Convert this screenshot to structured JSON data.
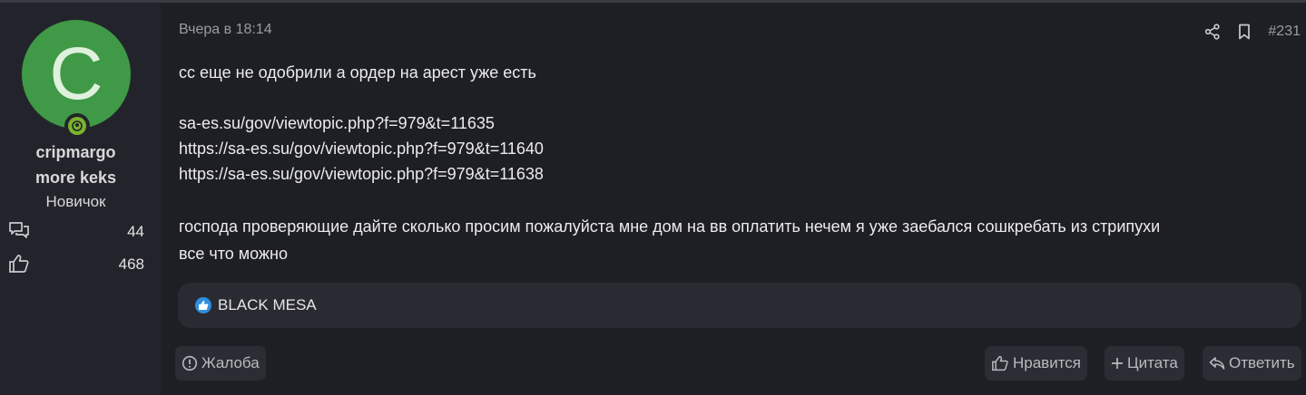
{
  "author": {
    "avatar_letter": "C",
    "name_line1": "cripmargo",
    "name_line2": "more keks",
    "rank": "Новичок",
    "messages_count": "44",
    "reactions_count": "468",
    "avatar_color": "#3f9946",
    "online_color": "#7ab32f"
  },
  "post": {
    "date": "Вчера в 18:14",
    "number": "#231",
    "lines": [
      "сс еще не одобрили а ордер на арест уже есть",
      "sa-es.su/gov/viewtopic.php?f=979&t=11635",
      "https://sa-es.su/gov/viewtopic.php?f=979&t=11640",
      "https://sa-es.su/gov/viewtopic.php?f=979&t=11638",
      "господа проверяющие дайте сколько просим пожалуйста мне дом на вв оплатить нечем я уже заебался сошкребать из стрипухи",
      "все что можно"
    ]
  },
  "reactions": {
    "users": "BLACK MESA",
    "icon": "thumbs-up-icon",
    "badge_color": "#2f8fe0"
  },
  "actions": {
    "report": "Жалоба",
    "like": "Нравится",
    "quote": "Цитата",
    "reply": "Ответить"
  }
}
